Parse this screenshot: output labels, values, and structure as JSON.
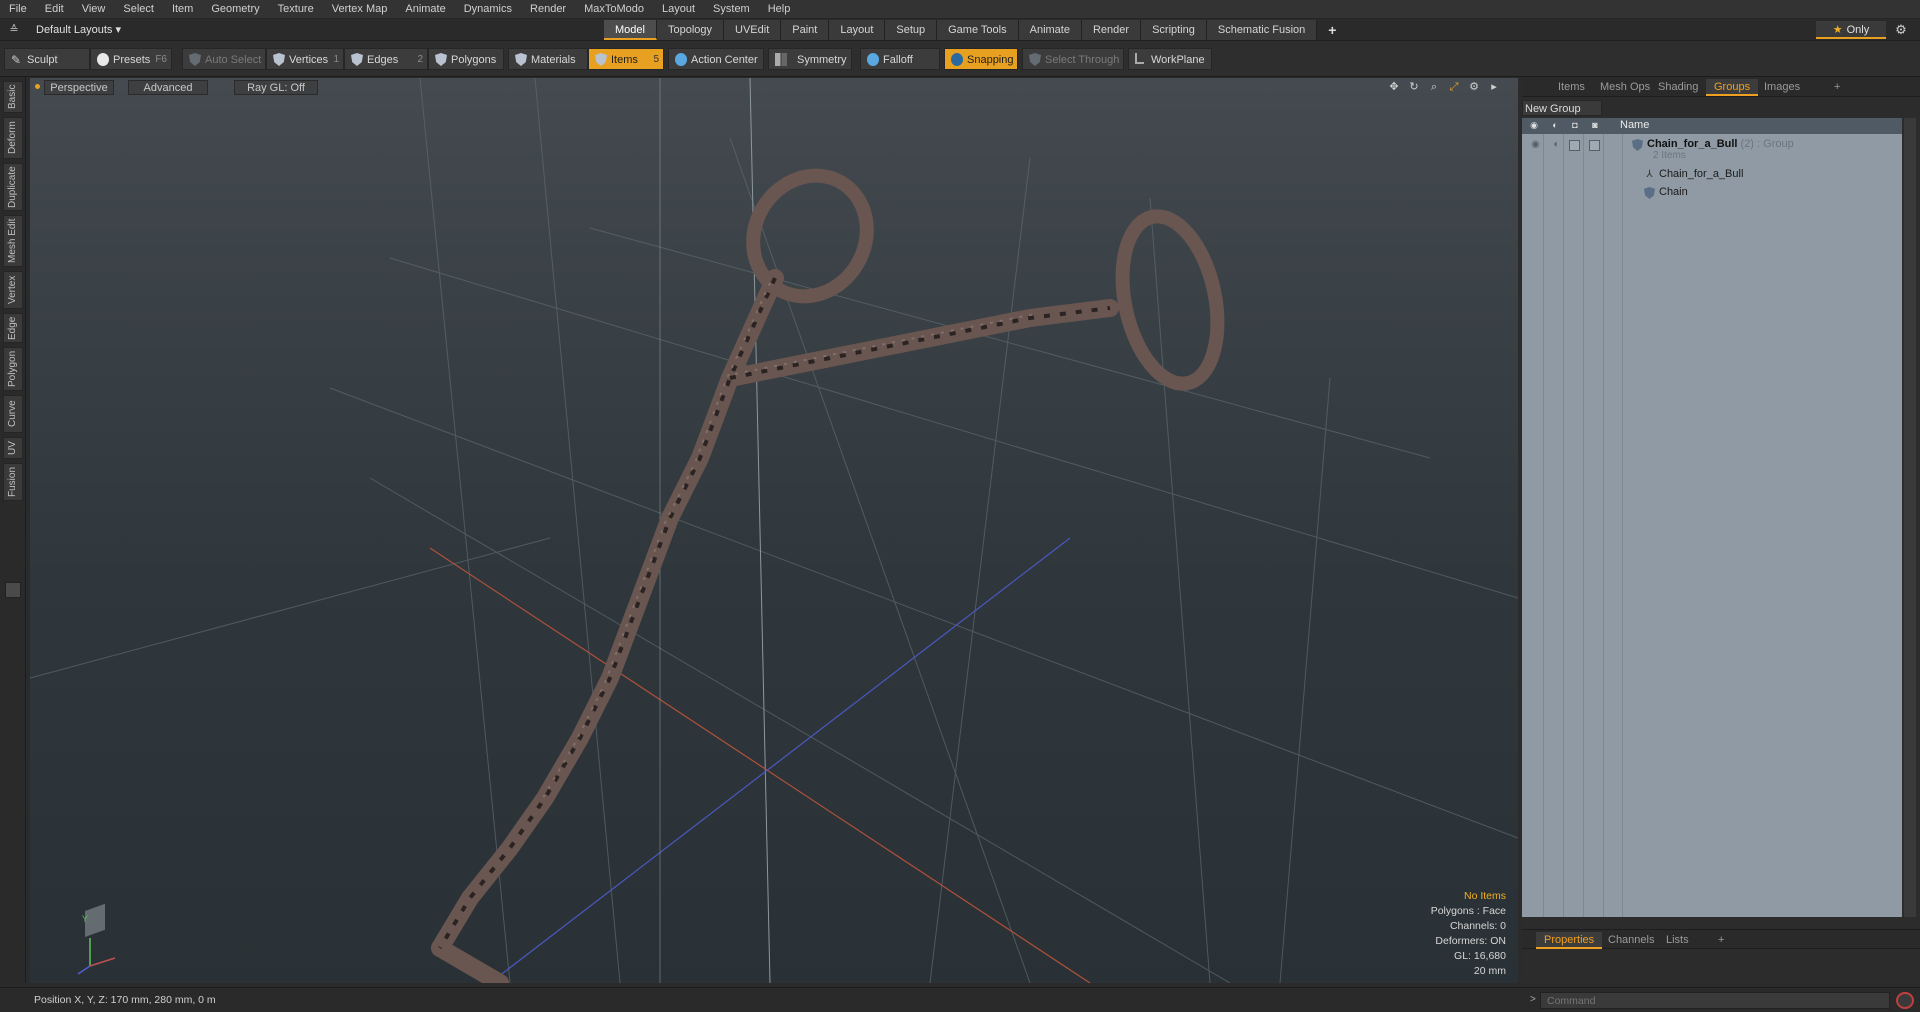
{
  "menu": [
    "File",
    "Edit",
    "View",
    "Select",
    "Item",
    "Geometry",
    "Texture",
    "Vertex Map",
    "Animate",
    "Dynamics",
    "Render",
    "MaxToModo",
    "Layout",
    "System",
    "Help"
  ],
  "layout": {
    "selector": "Default Layouts ▾",
    "tabs": [
      "Model",
      "Topology",
      "UVEdit",
      "Paint",
      "Layout",
      "Setup",
      "Game Tools",
      "Animate",
      "Render",
      "Scripting",
      "Schematic Fusion"
    ],
    "active_tab": "Model",
    "plus": "+",
    "only_label": "Only"
  },
  "toolbar": {
    "sculpt": "Sculpt",
    "presets": "Presets",
    "presets_key": "F6",
    "auto_select": "Auto Select",
    "vertices": "Vertices",
    "vertices_key": "1",
    "edges": "Edges",
    "edges_key": "2",
    "polygons": "Polygons",
    "materials": "Materials",
    "items": "Items",
    "items_key": "5",
    "action_center": "Action Center",
    "symmetry": "Symmetry",
    "falloff": "Falloff",
    "snapping": "Snapping",
    "select_through": "Select Through",
    "workplane": "WorkPlane"
  },
  "left_tabs": [
    "Basic",
    "Deform",
    "Duplicate",
    "Mesh Edit",
    "Vertex",
    "Edge",
    "Polygon",
    "Curve",
    "UV",
    "Fusion"
  ],
  "viewport": {
    "view": "Perspective",
    "shading": "Advanced",
    "raygl": "Ray GL: Off",
    "info": {
      "items": "No Items",
      "polygons": "Polygons : Face",
      "channels": "Channels: 0",
      "deformers": "Deformers: ON",
      "gl": "GL: 16,680",
      "scale": "20 mm"
    },
    "axis_y": "Y"
  },
  "right_panel": {
    "tabs": [
      "Items",
      "Mesh Ops",
      "Shading",
      "Groups",
      "Images"
    ],
    "active_tab": "Groups",
    "plus": "+",
    "new_group": "New Group",
    "column_name": "Name",
    "group": {
      "name": "Chain_for_a_Bull",
      "count": "(2)",
      "type": ": Group",
      "sub": "2 Items",
      "children": [
        "Chain_for_a_Bull",
        "Chain"
      ]
    },
    "bottom_tabs": [
      "Properties",
      "Channels",
      "Lists"
    ],
    "bottom_active": "Properties"
  },
  "status": {
    "position": "Position X, Y, Z:   170 mm, 280 mm, 0 m"
  },
  "command": {
    "prompt": ">",
    "placeholder": "Command"
  }
}
